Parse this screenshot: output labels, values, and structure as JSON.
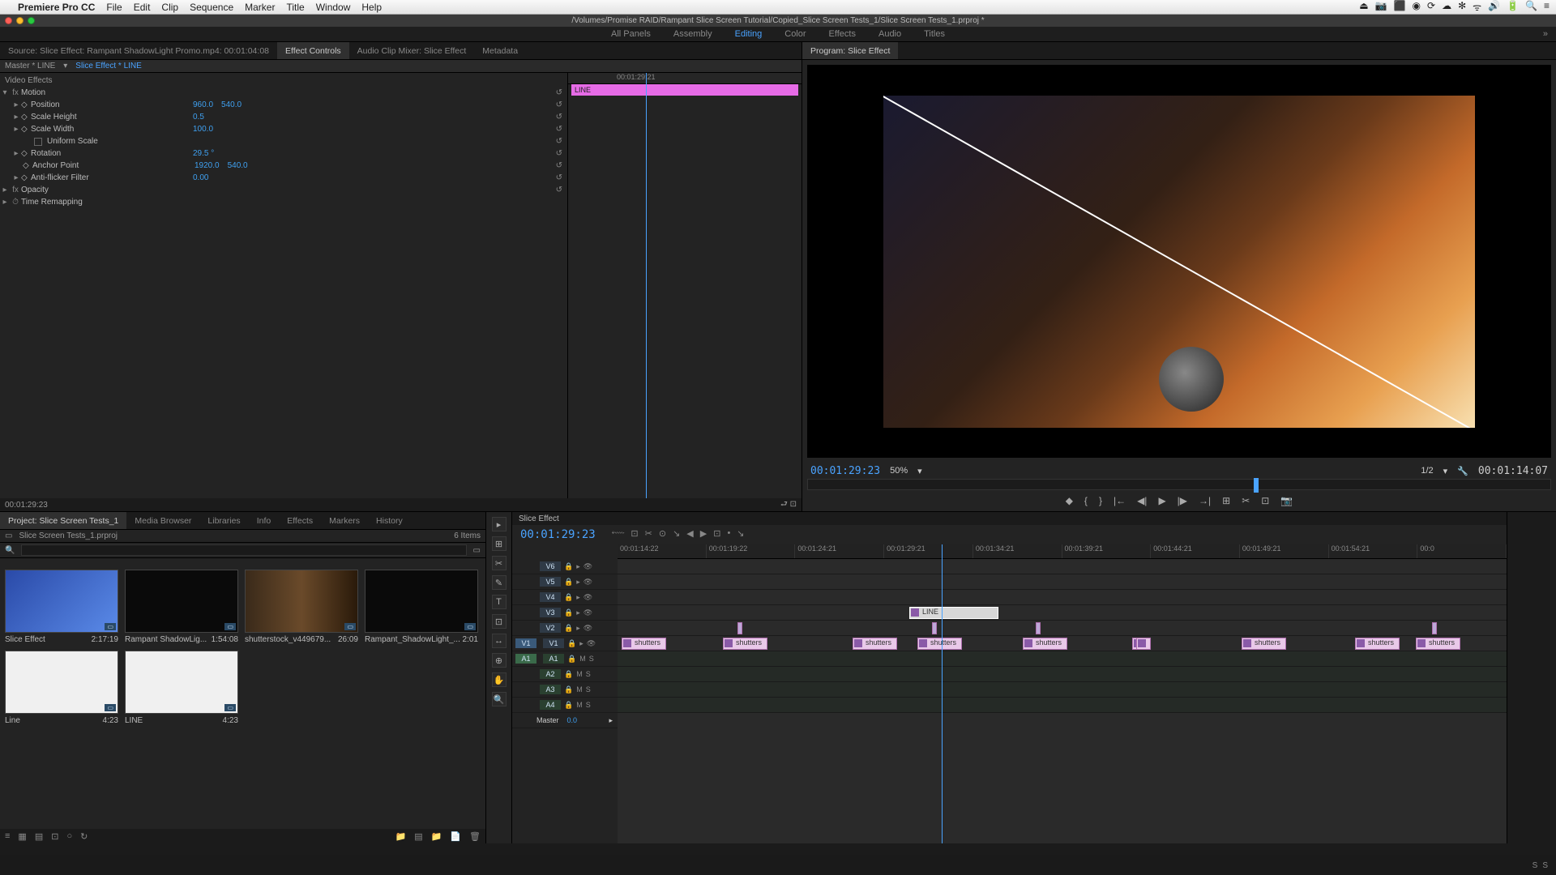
{
  "mac": {
    "app": "Premiere Pro CC",
    "menus": [
      "File",
      "Edit",
      "Clip",
      "Sequence",
      "Marker",
      "Title",
      "Window",
      "Help"
    ],
    "tray": [
      "⏏",
      "📷",
      "⬛",
      "◉",
      "⟳",
      "☁",
      "✻",
      "ᯤ",
      "🔊",
      "🔋",
      "🔍",
      "≡"
    ]
  },
  "doc_title": "/Volumes/Promise RAID/Rampant Slice Screen Tutorial/Copied_Slice Screen Tests_1/Slice Screen Tests_1.prproj *",
  "workspaces": {
    "items": [
      "All Panels",
      "Assembly",
      "Editing",
      "Color",
      "Effects",
      "Audio",
      "Titles"
    ],
    "active": "Editing"
  },
  "source": {
    "tabs": [
      "Source: Slice Effect: Rampant ShadowLight Promo.mp4: 00:01:04:08",
      "Effect Controls",
      "Audio Clip Mixer: Slice Effect",
      "Metadata"
    ],
    "active": 1,
    "header": {
      "master": "Master * LINE",
      "clip": "Slice Effect * LINE"
    },
    "sections": {
      "video": "Video Effects"
    },
    "motion": {
      "label": "Motion",
      "fx": "fx",
      "rows": [
        {
          "label": "Position",
          "v1": "960.0",
          "v2": "540.0"
        },
        {
          "label": "Scale Height",
          "v1": "0.5"
        },
        {
          "label": "Scale Width",
          "v1": "100.0"
        },
        {
          "label": "Uniform Scale",
          "checkbox": true
        },
        {
          "label": "Rotation",
          "v1": "29.5 °"
        },
        {
          "label": "Anchor Point",
          "v1": "1920.0",
          "v2": "540.0"
        },
        {
          "label": "Anti-flicker Filter",
          "v1": "0.00"
        }
      ]
    },
    "opacity": {
      "label": "Opacity"
    },
    "timeremap": {
      "label": "Time Remapping"
    },
    "ruler_tc": "00:01:29:21",
    "clip_label": "LINE",
    "footer_tc": "00:01:29:23"
  },
  "program": {
    "tab": "Program: Slice Effect",
    "tc": "00:01:29:23",
    "zoom": "50%",
    "fit": "1/2",
    "dur": "00:01:14:07",
    "buttons": [
      "◆",
      "{",
      "}",
      "|←",
      "◀|",
      "▶",
      "|▶",
      "→|",
      "⊞",
      "✂",
      "⊡",
      "📷"
    ]
  },
  "project": {
    "tabs": [
      "Project: Slice Screen Tests_1",
      "Media Browser",
      "Libraries",
      "Info",
      "Effects",
      "Markers",
      "History"
    ],
    "file": "Slice Screen Tests_1.prproj",
    "count": "6 Items",
    "items": [
      {
        "name": "Slice Effect",
        "dur": "2:17:19",
        "thumb": "blue"
      },
      {
        "name": "Rampant ShadowLig...",
        "dur": "1:54:08",
        "thumb": "black"
      },
      {
        "name": "shutterstock_v449679...",
        "dur": "26:09",
        "thumb": "band"
      },
      {
        "name": "Rampant_ShadowLight_...",
        "dur": "2:01",
        "thumb": "black"
      },
      {
        "name": "Line",
        "dur": "4:23",
        "thumb": "white"
      },
      {
        "name": "LINE",
        "dur": "4:23",
        "thumb": "white"
      }
    ],
    "footer_icons": [
      "≡",
      "▦",
      "▤",
      "⊡",
      "🗑",
      "○",
      "↻"
    ],
    "footer_right": [
      "📁",
      "▤",
      "📁",
      "📄",
      "🗑"
    ]
  },
  "tools": [
    "▸",
    "⊞",
    "✂",
    "✎",
    "T",
    "⊡",
    "↔",
    "⊕",
    "✋",
    "🔍"
  ],
  "timeline": {
    "tab": "Slice Effect",
    "tc": "00:01:29:23",
    "toolbar": [
      "⬳",
      "⊡",
      "✂",
      "⊙",
      "↘",
      "◀",
      "▶",
      "⊡",
      "•",
      "↘"
    ],
    "ruler": [
      "00:01:14:22",
      "00:01:19:22",
      "00:01:24:21",
      "00:01:29:21",
      "00:01:34:21",
      "00:01:39:21",
      "00:01:44:21",
      "00:01:49:21",
      "00:01:54:21",
      "00:0"
    ],
    "vtracks": [
      "V6",
      "V5",
      "V4",
      "V3",
      "V2",
      "V1"
    ],
    "atracks": [
      "A1",
      "A2",
      "A3",
      "A4"
    ],
    "master": {
      "label": "Master",
      "val": "0.0"
    },
    "clip_name": "shutters",
    "line_clip": "LINE",
    "head_icons": [
      "🔒",
      "▸",
      "👁"
    ]
  },
  "meters": {
    "s": "S"
  }
}
